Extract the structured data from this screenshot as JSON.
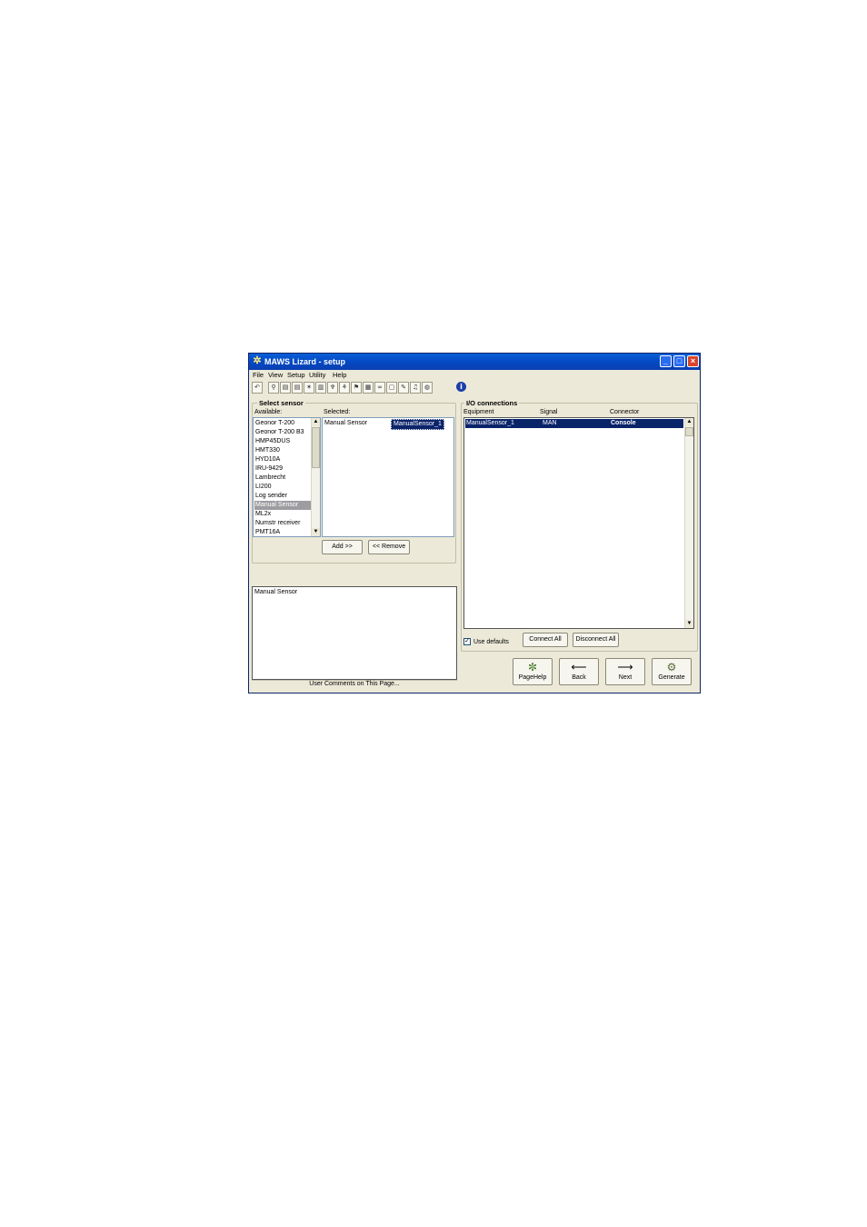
{
  "window": {
    "title": "MAWS Lizard - setup",
    "controls": {
      "minimize": "_",
      "maximize": "□",
      "close": "×"
    }
  },
  "menu": [
    "File",
    "View",
    "Setup",
    "Utility",
    "Help"
  ],
  "toolbar_icons": [
    "back-arrow-icon",
    "network-icon",
    "dev-icon",
    "dev-icon",
    "sensor-icon",
    "io-icon",
    "plug-icon",
    "run-icon",
    "flag-icon",
    "calculator-icon",
    "link-icon",
    "page-icon",
    "pencil-icon",
    "bell-icon",
    "globe-icon",
    "info-icon"
  ],
  "select_sensor": {
    "title": "Select sensor",
    "available_label": "Available:",
    "selected_label": "Selected:",
    "available": [
      "Geonor T-200",
      "Geonor T-200 B3",
      "HMP45DUS",
      "HMT330",
      "HYD10A",
      "IRU-9429",
      "Lambrecht",
      "LI200",
      "Log sender",
      "Manual Sensor",
      "ML2x",
      "Numstr receiver",
      "PMT16A"
    ],
    "available_selected": "Manual Sensor",
    "selected": [
      {
        "type": "Manual Sensor",
        "name": "ManualSensor_1"
      }
    ],
    "add_button": "Add >>",
    "remove_button": "<< Remove"
  },
  "comments": {
    "text": "Manual Sensor",
    "caption": "User Comments on This Page..."
  },
  "io_connections": {
    "title": "I/O connections",
    "columns": [
      "Equipment",
      "Signal",
      "Connector"
    ],
    "rows": [
      {
        "equipment": "ManualSensor_1",
        "signal": "MAN",
        "connector": "Console"
      }
    ],
    "use_defaults_label": "Use defaults",
    "use_defaults_checked": true,
    "connect_all": "Connect All",
    "disconnect_all": "Disconnect All"
  },
  "nav_buttons": {
    "pagehelp": "PageHelp",
    "back": "Back",
    "next": "Next",
    "generate": "Generate"
  }
}
